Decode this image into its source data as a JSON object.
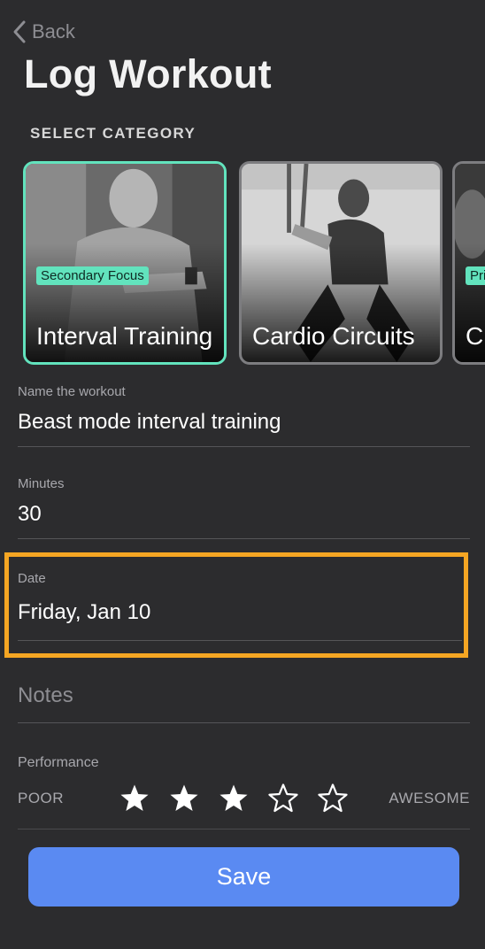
{
  "nav": {
    "back_label": "Back"
  },
  "title": "Log Workout",
  "category_section": {
    "label": "SELECT CATEGORY",
    "cards": [
      {
        "badge": "Secondary Focus",
        "title": "Interval Training",
        "selected": true
      },
      {
        "badge": "",
        "title": "Cardio Circuits",
        "selected": false
      },
      {
        "badge": "Pri",
        "title": "Cl Tr",
        "selected": false
      }
    ]
  },
  "form": {
    "name": {
      "label": "Name the workout",
      "value": "Beast mode interval training"
    },
    "minutes": {
      "label": "Minutes",
      "value": "30"
    },
    "date": {
      "label": "Date",
      "value": "Friday, Jan 10"
    },
    "notes": {
      "placeholder": "Notes"
    },
    "performance": {
      "label": "Performance",
      "min_label": "POOR",
      "max_label": "AWESOME",
      "rating": 3,
      "max_rating": 5
    }
  },
  "save_label": "Save",
  "colors": {
    "background": "#2c2c2e",
    "accent_teal": "#62e3bd",
    "save_blue": "#5a8af2",
    "highlight_orange": "#f5a623"
  }
}
